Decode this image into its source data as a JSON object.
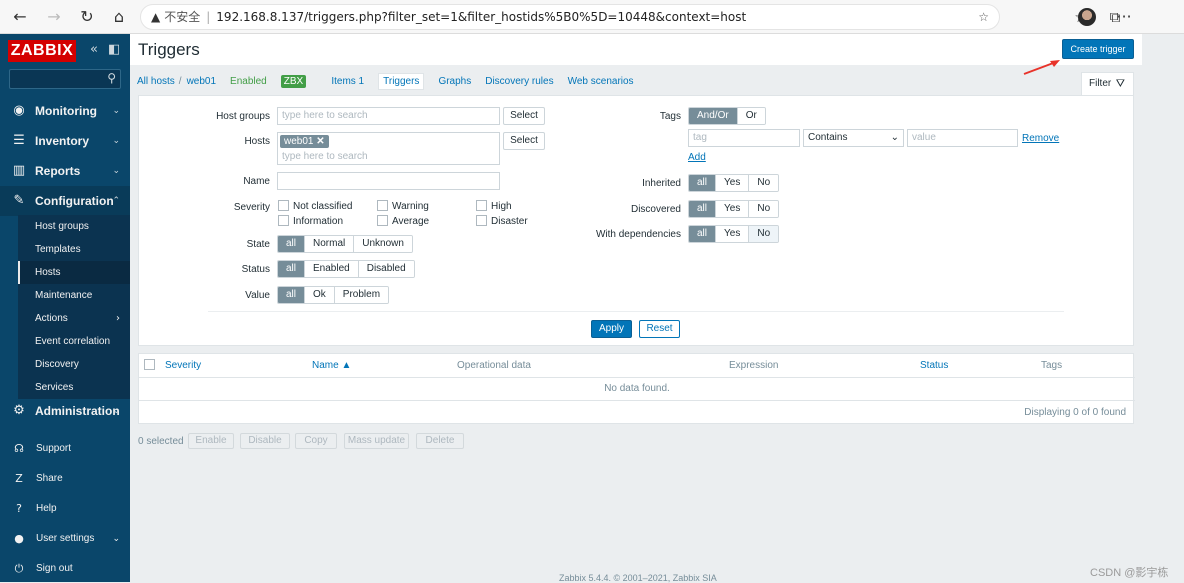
{
  "browser": {
    "url": "192.168.8.137/triggers.php?filter_set=1&filter_hostids%5B0%5D=10448&context=host",
    "security_label": "不安全"
  },
  "sidebar": {
    "logo": "ZABBIX",
    "menu": [
      {
        "label": "Monitoring"
      },
      {
        "label": "Inventory"
      },
      {
        "label": "Reports"
      },
      {
        "label": "Configuration"
      },
      {
        "label": "Administration"
      }
    ],
    "config_items": [
      "Host groups",
      "Templates",
      "Hosts",
      "Maintenance",
      "Actions",
      "Event correlation",
      "Discovery",
      "Services"
    ],
    "lower": [
      "Support",
      "Share",
      "Help",
      "User settings",
      "Sign out"
    ]
  },
  "header": {
    "title": "Triggers",
    "create_button": "Create trigger"
  },
  "breadcrumbs": {
    "all_hosts": "All hosts",
    "sep": "/",
    "host": "web01",
    "status": "Enabled",
    "zbx": "ZBX",
    "items": "Items 1",
    "triggers": "Triggers",
    "graphs": "Graphs",
    "discovery": "Discovery rules",
    "web": "Web scenarios"
  },
  "filter_tab": "Filter",
  "filter": {
    "host_groups_label": "Host groups",
    "host_groups_placeholder": "type here to search",
    "select": "Select",
    "hosts_label": "Hosts",
    "host_chip": "web01",
    "hosts_placeholder": "type here to search",
    "name_label": "Name",
    "severity_label": "Severity",
    "severities": [
      "Not classified",
      "Warning",
      "High",
      "Information",
      "Average",
      "Disaster"
    ],
    "state_label": "State",
    "state_opts": [
      "all",
      "Normal",
      "Unknown"
    ],
    "status_label": "Status",
    "status_opts": [
      "all",
      "Enabled",
      "Disabled"
    ],
    "value_label": "Value",
    "value_opts": [
      "all",
      "Ok",
      "Problem"
    ],
    "tags_label": "Tags",
    "tags_opts": [
      "And/Or",
      "Or"
    ],
    "tag_placeholder": "tag",
    "tag_operator": "Contains",
    "value_placeholder": "value",
    "remove": "Remove",
    "add": "Add",
    "inherited_label": "Inherited",
    "discovered_label": "Discovered",
    "deps_label": "With dependencies",
    "yn_opts": [
      "all",
      "Yes",
      "No"
    ],
    "apply": "Apply",
    "reset": "Reset"
  },
  "table": {
    "headers": [
      "Severity",
      "Name ▲",
      "Operational data",
      "Expression",
      "Status",
      "Tags"
    ],
    "empty": "No data found.",
    "displaying": "Displaying 0 of 0 found"
  },
  "actions": {
    "selected": "0 selected",
    "buttons": [
      "Enable",
      "Disable",
      "Copy",
      "Mass update",
      "Delete"
    ]
  },
  "footer": "Zabbix 5.4.4. © 2001–2021, Zabbix SIA",
  "watermark": "CSDN @影宇栋"
}
